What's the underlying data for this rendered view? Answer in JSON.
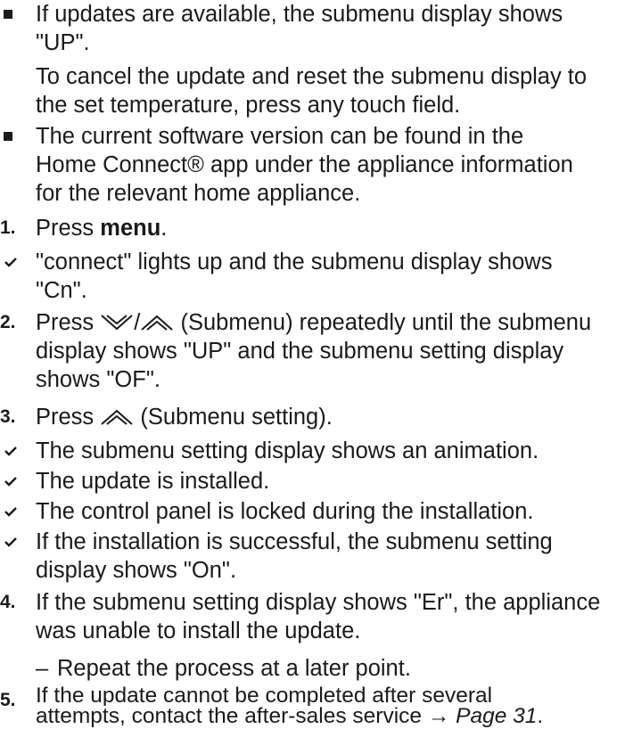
{
  "bullets": [
    {
      "lines": [
        "If updates are available, the submenu display shows",
        "\"UP\"."
      ],
      "note_lines": [
        "To cancel the update and reset the submenu display to",
        "the set temperature, press any touch field."
      ]
    },
    {
      "lines": [
        "The current software version can be found in the",
        "Home Connect® app under the appliance information",
        "for the relevant home appliance."
      ]
    }
  ],
  "steps": {
    "s1": {
      "num": "1.",
      "pre": "Press ",
      "bold": "menu",
      "post": "."
    },
    "r1": [
      "\"connect\" lights up and the submenu display shows",
      "\"Cn\"."
    ],
    "s2": {
      "num": "2.",
      "pre": "Press ",
      "sep": "/",
      "post": " (Submenu) repeatedly until the submenu",
      "lines": [
        "display shows \"UP\" and the submenu setting display",
        "shows \"OF\"."
      ]
    },
    "s3": {
      "num": "3.",
      "pre": "Press ",
      "post": " (Submenu setting)."
    },
    "r3": [
      [
        "The submenu setting display shows an animation."
      ],
      [
        "The update is installed."
      ],
      [
        "The control panel is locked during the installation."
      ],
      [
        "If the installation is successful, the submenu setting",
        "display shows \"On\"."
      ]
    ],
    "s4": {
      "num": "4.",
      "lines": [
        "If the submenu setting display shows \"Er\", the appliance",
        "was unable to install the update."
      ],
      "sub_marker": "–",
      "sub": "Repeat the process at a later point."
    },
    "s5": {
      "num": "5.",
      "line1": "If the update cannot be completed after several",
      "line2_pre": "attempts, contact the after-sales service → ",
      "line2_link": "Page 31",
      "line2_post": "."
    }
  },
  "icons": {
    "bullet": "square-bullet-icon",
    "result": "check-icon",
    "down": "chevron-down-icon",
    "up": "chevron-up-icon"
  }
}
